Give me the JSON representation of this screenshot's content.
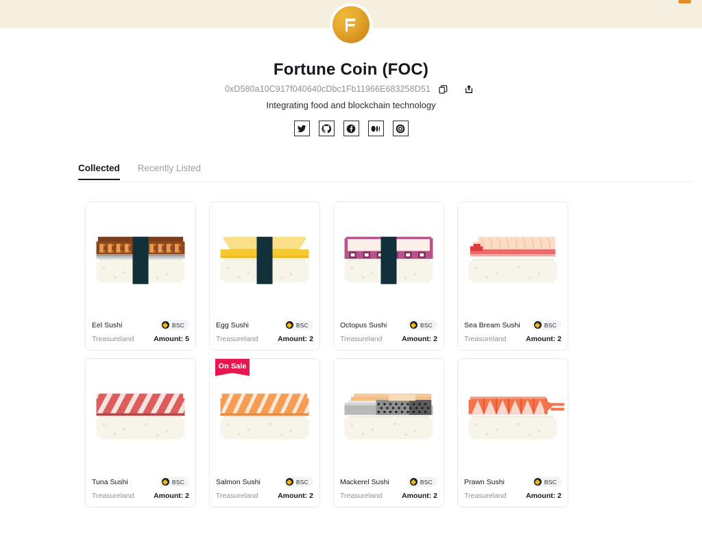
{
  "banner": {
    "accent_color": "#e08c21",
    "background_color": "#f7f0e0"
  },
  "logo": {
    "letter": "F",
    "name": "fortune-coin-logo"
  },
  "header": {
    "title": "Fortune Coin (FOC)",
    "address": "0xD580a10C917f040640cDbc1Fb11966E683258D51",
    "copy_icon": "copy-icon",
    "share_icon": "share-icon",
    "subtitle": "Integrating food and blockchain technology"
  },
  "socials": [
    {
      "name": "twitter-icon",
      "label": "Twitter"
    },
    {
      "name": "github-icon",
      "label": "GitHub"
    },
    {
      "name": "facebook-icon",
      "label": "Facebook"
    },
    {
      "name": "medium-icon",
      "label": "Medium"
    },
    {
      "name": "instagram-icon",
      "label": "Instagram"
    }
  ],
  "tabs": [
    {
      "label": "Collected",
      "active": true
    },
    {
      "label": "Recently Listed",
      "active": false
    }
  ],
  "chain": {
    "label": "BSC",
    "accent_color": "#f0b90b"
  },
  "sale_badge": {
    "label": "On Sale",
    "color": "#e8164f"
  },
  "cards": [
    {
      "name": "Eel Sushi",
      "collection": "Treasureland",
      "chain": "BSC",
      "amount": "Amount: 5",
      "art": "eel",
      "on_sale": false
    },
    {
      "name": "Egg Sushi",
      "collection": "Treasureland",
      "chain": "BSC",
      "amount": "Amount: 2",
      "art": "egg",
      "on_sale": false
    },
    {
      "name": "Octopus Sushi",
      "collection": "Treasureland",
      "chain": "BSC",
      "amount": "Amount: 2",
      "art": "octopus",
      "on_sale": false
    },
    {
      "name": "Sea Bream Sushi",
      "collection": "Treasureland",
      "chain": "BSC",
      "amount": "Amount: 2",
      "art": "seabream",
      "on_sale": false
    },
    {
      "name": "Tuna Sushi",
      "collection": "Treasureland",
      "chain": "BSC",
      "amount": "Amount: 2",
      "art": "tuna",
      "on_sale": false
    },
    {
      "name": "Salmon Sushi",
      "collection": "Treasureland",
      "chain": "BSC",
      "amount": "Amount: 2",
      "art": "salmon",
      "on_sale": true
    },
    {
      "name": "Mackerel Sushi",
      "collection": "Treasureland",
      "chain": "BSC",
      "amount": "Amount: 2",
      "art": "mackerel",
      "on_sale": false
    },
    {
      "name": "Prawn Sushi",
      "collection": "Treasureland",
      "chain": "BSC",
      "amount": "Amount: 2",
      "art": "prawn",
      "on_sale": false
    }
  ]
}
